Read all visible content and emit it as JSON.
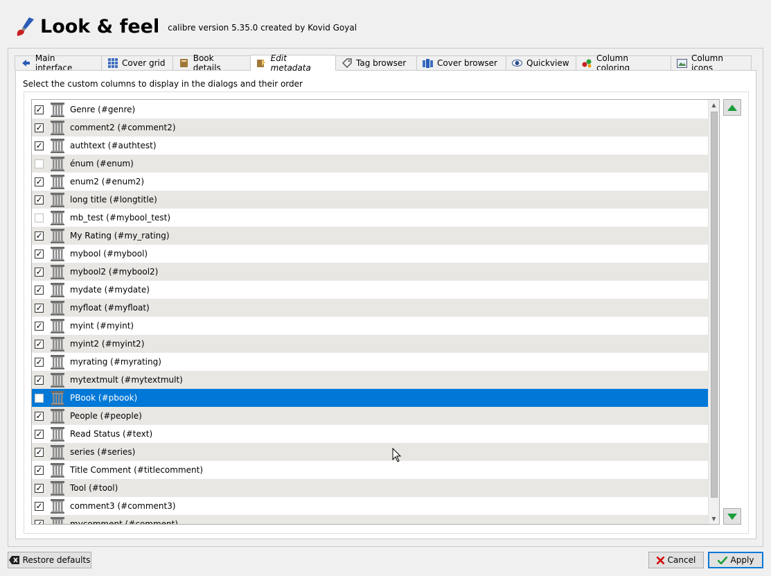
{
  "header": {
    "title": "Look & feel",
    "subtitle": "calibre version 5.35.0 created by Kovid Goyal",
    "icon": "paint-brush-icon"
  },
  "tabs": [
    {
      "label": "Main interface",
      "icon": "arrow-left-icon",
      "active": false
    },
    {
      "label": "Cover grid",
      "icon": "grid-icon",
      "active": false
    },
    {
      "label": "Book details",
      "icon": "book-icon",
      "active": false
    },
    {
      "label": "Edit metadata",
      "icon": "book-edit-icon",
      "active": true
    },
    {
      "label": "Tag browser",
      "icon": "tag-icon",
      "active": false
    },
    {
      "label": "Cover browser",
      "icon": "cover-browser-icon",
      "active": false
    },
    {
      "label": "Quickview",
      "icon": "eye-icon",
      "active": false
    },
    {
      "label": "Column coloring",
      "icon": "palette-icon",
      "active": false
    },
    {
      "label": "Column icons",
      "icon": "column-icons-icon",
      "active": false
    }
  ],
  "instruction": "Select the custom columns to display in the dialogs and their order",
  "columns": [
    {
      "label": "Genre (#genre)",
      "checked": true
    },
    {
      "label": "comment2 (#comment2)",
      "checked": true
    },
    {
      "label": "authtext (#authtest)",
      "checked": true
    },
    {
      "label": "énum (#enum)",
      "checked": false
    },
    {
      "label": "enum2 (#enum2)",
      "checked": true
    },
    {
      "label": "long title (#longtitle)",
      "checked": true
    },
    {
      "label": "mb_test (#mybool_test)",
      "checked": false
    },
    {
      "label": "My Rating (#my_rating)",
      "checked": true
    },
    {
      "label": "mybool (#mybool)",
      "checked": true
    },
    {
      "label": "mybool2 (#mybool2)",
      "checked": true
    },
    {
      "label": "mydate (#mydate)",
      "checked": true
    },
    {
      "label": "myfloat (#myfloat)",
      "checked": true
    },
    {
      "label": "myint (#myint)",
      "checked": true
    },
    {
      "label": "myint2 (#myint2)",
      "checked": true
    },
    {
      "label": "myrating (#myrating)",
      "checked": true
    },
    {
      "label": "mytextmult (#mytextmult)",
      "checked": true
    },
    {
      "label": "PBook (#pbook)",
      "checked": false,
      "selected": true
    },
    {
      "label": "People (#people)",
      "checked": true
    },
    {
      "label": "Read Status (#text)",
      "checked": true
    },
    {
      "label": "series (#series)",
      "checked": true
    },
    {
      "label": "Title Comment (#titlecomment)",
      "checked": true
    },
    {
      "label": "Tool (#tool)",
      "checked": true
    },
    {
      "label": "comment3 (#comment3)",
      "checked": true
    },
    {
      "label": "mycomment (#comment)",
      "checked": true
    }
  ],
  "buttons": {
    "restore_defaults": "Restore defaults",
    "cancel": "Cancel",
    "apply": "Apply"
  },
  "colors": {
    "selection": "#0078d7",
    "alt_row": "#e9e7e3",
    "move_arrow": "#1a9e3a",
    "cancel_x": "#d40000",
    "apply_check": "#1a9e3a"
  }
}
